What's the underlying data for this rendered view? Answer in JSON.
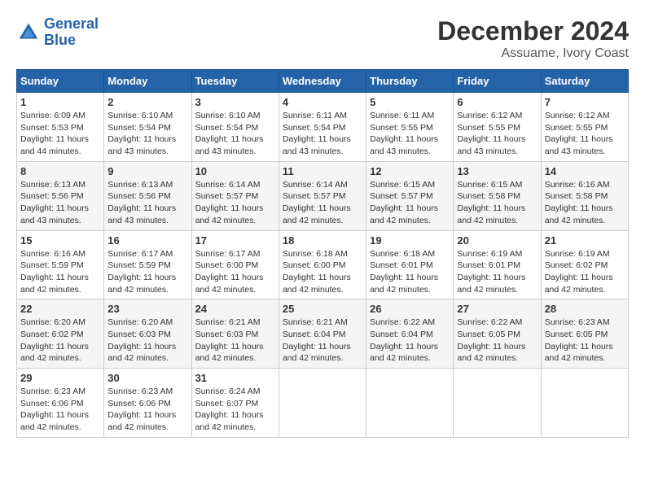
{
  "header": {
    "logo_line1": "General",
    "logo_line2": "Blue",
    "month_title": "December 2024",
    "location": "Assuame, Ivory Coast"
  },
  "weekdays": [
    "Sunday",
    "Monday",
    "Tuesday",
    "Wednesday",
    "Thursday",
    "Friday",
    "Saturday"
  ],
  "weeks": [
    [
      {
        "day": "1",
        "sunrise": "6:09 AM",
        "sunset": "5:53 PM",
        "daylight": "11 hours and 44 minutes."
      },
      {
        "day": "2",
        "sunrise": "6:10 AM",
        "sunset": "5:54 PM",
        "daylight": "11 hours and 43 minutes."
      },
      {
        "day": "3",
        "sunrise": "6:10 AM",
        "sunset": "5:54 PM",
        "daylight": "11 hours and 43 minutes."
      },
      {
        "day": "4",
        "sunrise": "6:11 AM",
        "sunset": "5:54 PM",
        "daylight": "11 hours and 43 minutes."
      },
      {
        "day": "5",
        "sunrise": "6:11 AM",
        "sunset": "5:55 PM",
        "daylight": "11 hours and 43 minutes."
      },
      {
        "day": "6",
        "sunrise": "6:12 AM",
        "sunset": "5:55 PM",
        "daylight": "11 hours and 43 minutes."
      },
      {
        "day": "7",
        "sunrise": "6:12 AM",
        "sunset": "5:55 PM",
        "daylight": "11 hours and 43 minutes."
      }
    ],
    [
      {
        "day": "8",
        "sunrise": "6:13 AM",
        "sunset": "5:56 PM",
        "daylight": "11 hours and 43 minutes."
      },
      {
        "day": "9",
        "sunrise": "6:13 AM",
        "sunset": "5:56 PM",
        "daylight": "11 hours and 43 minutes."
      },
      {
        "day": "10",
        "sunrise": "6:14 AM",
        "sunset": "5:57 PM",
        "daylight": "11 hours and 42 minutes."
      },
      {
        "day": "11",
        "sunrise": "6:14 AM",
        "sunset": "5:57 PM",
        "daylight": "11 hours and 42 minutes."
      },
      {
        "day": "12",
        "sunrise": "6:15 AM",
        "sunset": "5:57 PM",
        "daylight": "11 hours and 42 minutes."
      },
      {
        "day": "13",
        "sunrise": "6:15 AM",
        "sunset": "5:58 PM",
        "daylight": "11 hours and 42 minutes."
      },
      {
        "day": "14",
        "sunrise": "6:16 AM",
        "sunset": "5:58 PM",
        "daylight": "11 hours and 42 minutes."
      }
    ],
    [
      {
        "day": "15",
        "sunrise": "6:16 AM",
        "sunset": "5:59 PM",
        "daylight": "11 hours and 42 minutes."
      },
      {
        "day": "16",
        "sunrise": "6:17 AM",
        "sunset": "5:59 PM",
        "daylight": "11 hours and 42 minutes."
      },
      {
        "day": "17",
        "sunrise": "6:17 AM",
        "sunset": "6:00 PM",
        "daylight": "11 hours and 42 minutes."
      },
      {
        "day": "18",
        "sunrise": "6:18 AM",
        "sunset": "6:00 PM",
        "daylight": "11 hours and 42 minutes."
      },
      {
        "day": "19",
        "sunrise": "6:18 AM",
        "sunset": "6:01 PM",
        "daylight": "11 hours and 42 minutes."
      },
      {
        "day": "20",
        "sunrise": "6:19 AM",
        "sunset": "6:01 PM",
        "daylight": "11 hours and 42 minutes."
      },
      {
        "day": "21",
        "sunrise": "6:19 AM",
        "sunset": "6:02 PM",
        "daylight": "11 hours and 42 minutes."
      }
    ],
    [
      {
        "day": "22",
        "sunrise": "6:20 AM",
        "sunset": "6:02 PM",
        "daylight": "11 hours and 42 minutes."
      },
      {
        "day": "23",
        "sunrise": "6:20 AM",
        "sunset": "6:03 PM",
        "daylight": "11 hours and 42 minutes."
      },
      {
        "day": "24",
        "sunrise": "6:21 AM",
        "sunset": "6:03 PM",
        "daylight": "11 hours and 42 minutes."
      },
      {
        "day": "25",
        "sunrise": "6:21 AM",
        "sunset": "6:04 PM",
        "daylight": "11 hours and 42 minutes."
      },
      {
        "day": "26",
        "sunrise": "6:22 AM",
        "sunset": "6:04 PM",
        "daylight": "11 hours and 42 minutes."
      },
      {
        "day": "27",
        "sunrise": "6:22 AM",
        "sunset": "6:05 PM",
        "daylight": "11 hours and 42 minutes."
      },
      {
        "day": "28",
        "sunrise": "6:23 AM",
        "sunset": "6:05 PM",
        "daylight": "11 hours and 42 minutes."
      }
    ],
    [
      {
        "day": "29",
        "sunrise": "6:23 AM",
        "sunset": "6:06 PM",
        "daylight": "11 hours and 42 minutes."
      },
      {
        "day": "30",
        "sunrise": "6:23 AM",
        "sunset": "6:06 PM",
        "daylight": "11 hours and 42 minutes."
      },
      {
        "day": "31",
        "sunrise": "6:24 AM",
        "sunset": "6:07 PM",
        "daylight": "11 hours and 42 minutes."
      },
      null,
      null,
      null,
      null
    ]
  ]
}
